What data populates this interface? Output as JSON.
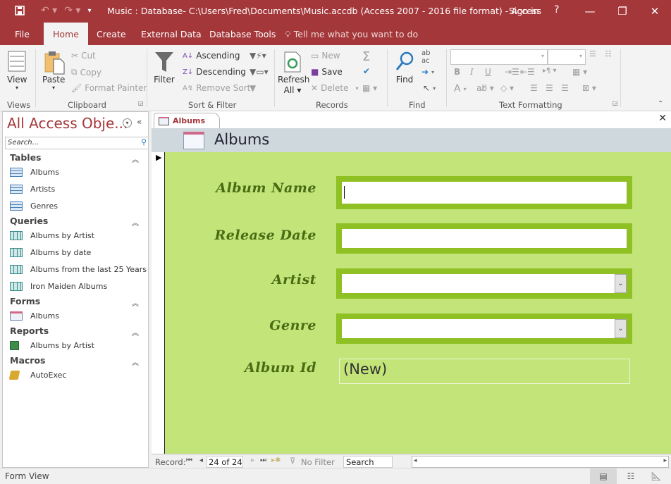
{
  "window": {
    "title": "Music : Database- C:\\Users\\Fred\\Documents\\Music.accdb (Access 2007 - 2016 file format) - Access",
    "sign_in": "Sign in",
    "help": "?",
    "minimize": "—",
    "restore": "❐",
    "close": "✕"
  },
  "ribbon_tabs": [
    {
      "label": "File"
    },
    {
      "label": "Home"
    },
    {
      "label": "Create"
    },
    {
      "label": "External Data"
    },
    {
      "label": "Database Tools"
    }
  ],
  "tell_me": "Tell me what you want to do",
  "ribbon": {
    "views": {
      "label": "Views",
      "view": "View"
    },
    "clipboard": {
      "label": "Clipboard",
      "paste": "Paste",
      "cut": "Cut",
      "copy": "Copy",
      "format_painter": "Format Painter"
    },
    "sort_filter": {
      "label": "Sort & Filter",
      "filter": "Filter",
      "ascending": "Ascending",
      "descending": "Descending",
      "remove_sort": "Remove Sort"
    },
    "records": {
      "label": "Records",
      "refresh": "Refresh",
      "refresh_all": "All",
      "new": "New",
      "save": "Save",
      "delete": "Delete"
    },
    "find": {
      "label": "Find",
      "find": "Find"
    },
    "text_formatting": {
      "label": "Text Formatting",
      "bold": "B",
      "italic": "I",
      "underline": "U",
      "font_color": "A"
    }
  },
  "nav_pane": {
    "title": "All Access Obje...",
    "search_placeholder": "Search...",
    "categories": [
      {
        "name": "Tables",
        "items": [
          "Albums",
          "Artists",
          "Genres"
        ]
      },
      {
        "name": "Queries",
        "items": [
          "Albums by Artist",
          "Albums by date",
          "Albums from the last 25 Years",
          "Iron Maiden Albums"
        ]
      },
      {
        "name": "Forms",
        "items": [
          "Albums"
        ]
      },
      {
        "name": "Reports",
        "items": [
          "Albums by Artist"
        ]
      },
      {
        "name": "Macros",
        "items": [
          "AutoExec"
        ]
      }
    ]
  },
  "document": {
    "tab_label": "Albums",
    "form_title": "Albums",
    "fields": [
      {
        "label": "Album Name",
        "value": "",
        "type": "text"
      },
      {
        "label": "Release Date",
        "value": "",
        "type": "text"
      },
      {
        "label": "Artist",
        "value": "",
        "type": "combo"
      },
      {
        "label": "Genre",
        "value": "",
        "type": "combo"
      },
      {
        "label": "Album Id",
        "value": "(New)",
        "type": "readonly"
      }
    ],
    "colors": {
      "form_bg": "#c2e478",
      "field_border": "#8fc024",
      "label": "#4a6b13",
      "header_bg": "#cfd8dc"
    }
  },
  "record_nav": {
    "label": "Record:",
    "current": "24 of 24",
    "filter": "No Filter",
    "search": "Search"
  },
  "status": {
    "view": "Form View"
  },
  "accent": "#a4373a"
}
